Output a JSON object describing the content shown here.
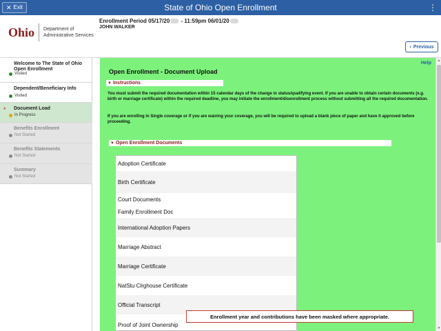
{
  "topbar": {
    "exit_label": "Exit",
    "title": "State of Ohio Open Enrollment",
    "menu_icon": "kebab-menu-icon"
  },
  "header": {
    "logo_text": "Ohio",
    "dept_text": "Department of Administrative Services",
    "period_label": "Enrollment Period 05/17/20",
    "period_mid": " - 11:59pm 06/01/20",
    "user_name": "JOHN WALKER",
    "previous_label": "Previous"
  },
  "sidebar": {
    "steps": [
      {
        "label": "Welcome to The State of Ohio Open Enrollment",
        "status": "Visited"
      },
      {
        "label": "Dependent/Beneficiary Info",
        "status": "Visited"
      },
      {
        "label": "Document Load",
        "status": "In Progress"
      },
      {
        "label": "Benefits Enrollment",
        "status": "Not Started"
      },
      {
        "label": "Benefits Statements",
        "status": "Not Started"
      },
      {
        "label": "Summary",
        "status": "Not Started"
      }
    ]
  },
  "content": {
    "help_label": "Help",
    "title": "Open Enrollment - Document Upload",
    "instructions_label": "Instructions",
    "para1": "You must submit the required documentation within 15 calendar days of the change in status/qualifying event. If you are unable to obtain certain documents (e.g. birth or marriage certificate) within the required deadline, you may initiate the enrollment/disenrollment process without submitting all the required documentation.",
    "para2": "If you are enrolling in Single coverage or if you are waiving your coverage, you will be required to upload a blank piece of paper and have it approved before proceeding.",
    "documents_label": "Open Enrollment Documents",
    "documents": [
      "Adoption Certificate",
      "Birth Certificate",
      "Court Documents",
      "Family Enrollment Doc",
      "International Adoption Papers",
      "Marriage Abstract",
      "Marriage Certificate",
      "NatStu Clrghouse Certificate",
      "Official Transcript",
      "Proof of Joint Ownership"
    ]
  },
  "notice": "Enrollment year and contributions have been masked where appropriate.",
  "colors": {
    "topbar": "#2c5fa3",
    "content_bg": "#7cf27c",
    "visited_dot": "#2e8b2e",
    "inprogress_dot": "#e0a800",
    "notstarted_dot": "#8a8a8a",
    "accent_red": "#8a1c1c"
  }
}
